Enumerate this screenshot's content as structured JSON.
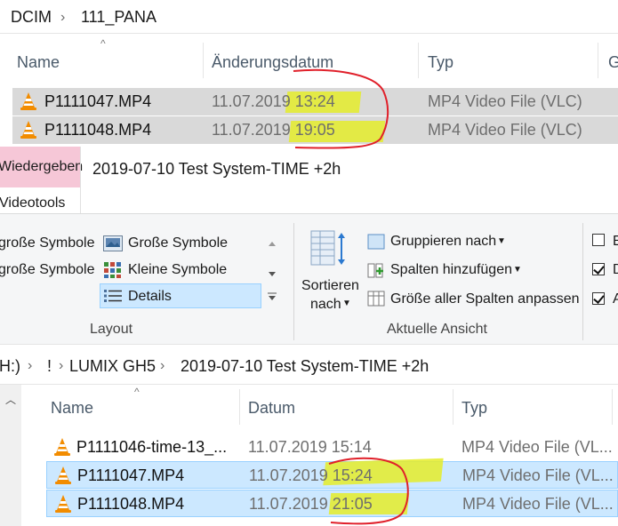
{
  "top_explorer": {
    "breadcrumb": [
      "DCIM",
      "111_PANA"
    ],
    "columns": [
      "Name",
      "Änderungsdatum",
      "Typ",
      "G"
    ],
    "rows": [
      {
        "name": "P1111047.MP4",
        "date_prefix": "11.07.2019 ",
        "time": "13:24",
        "type": "MP4 Video File (VLC)"
      },
      {
        "name": "P1111048.MP4",
        "date_prefix": "11.07.2019 ",
        "time": "19:05",
        "type": "MP4 Video File (VLC)"
      }
    ]
  },
  "ribbon": {
    "tabs": {
      "active": "Wiedergeben",
      "contextual": "Videotools"
    },
    "window_title": "2019-07-10 Test System-TIME +2h",
    "layout": {
      "items": [
        "große Symbole",
        "große Symbole",
        "Große Symbole",
        "Kleine Symbole",
        "Details"
      ],
      "label": "Layout"
    },
    "current_view": {
      "sort_label_1": "Sortieren",
      "sort_label_2": "nach",
      "group_by": "Gruppieren nach",
      "add_columns": "Spalten hinzufügen",
      "fit_columns": "Größe aller Spalten anpassen",
      "label": "Aktuelle Ansicht"
    },
    "show_hide": {
      "items": [
        {
          "label": "E",
          "checked": false
        },
        {
          "label": "D",
          "checked": true
        },
        {
          "label": "A",
          "checked": true
        }
      ]
    }
  },
  "bottom_explorer": {
    "breadcrumb": [
      "H:)",
      "!",
      "LUMIX GH5",
      "2019-07-10 Test System-TIME +2h"
    ],
    "columns": [
      "Name",
      "Datum",
      "Typ"
    ],
    "rows": [
      {
        "name": "P1111046-time-13_...",
        "date_prefix": "11.07.2019 ",
        "time": "15:14",
        "type": "MP4 Video File (VL...",
        "selected": false
      },
      {
        "name": "P1111047.MP4",
        "date_prefix": "11.07.2019 ",
        "time": "15:24",
        "type": "MP4 Video File (VL...",
        "selected": true
      },
      {
        "name": "P1111048.MP4",
        "date_prefix": "11.07.2019 ",
        "time": "21:05",
        "type": "MP4 Video File (VL...",
        "selected": true
      }
    ]
  },
  "colors": {
    "highlight": "#e4ec2a",
    "annotation": "#e0202a",
    "selection": "#cce8ff",
    "active_tab": "#f6c7d7"
  },
  "icons": [
    "vlc-cone-icon",
    "chevron-right-icon",
    "sort-up-icon",
    "large-icons-icon",
    "small-icons-icon",
    "details-icon",
    "sort-by-icon",
    "group-by-icon",
    "add-columns-icon",
    "fit-columns-icon",
    "checkbox-icon",
    "scroll-up-icon"
  ]
}
